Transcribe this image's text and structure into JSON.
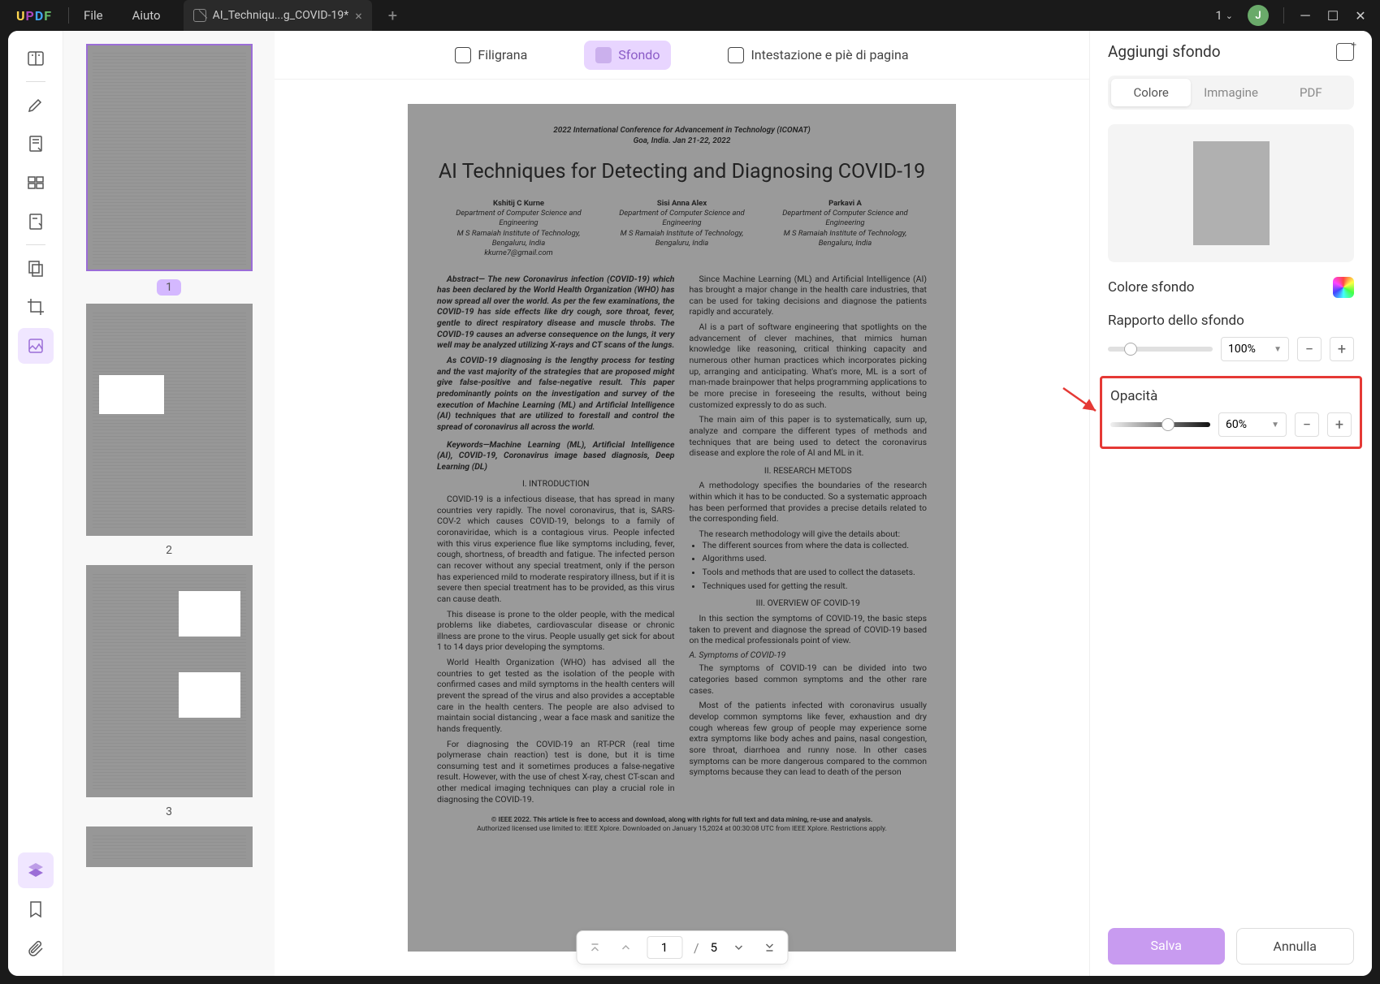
{
  "titlebar": {
    "menu_file": "File",
    "menu_help": "Aiuto",
    "tab_name": "AI_Techniqu...g_COVID-19*",
    "window_count": "1",
    "avatar_letter": "J"
  },
  "modebar": {
    "watermark": "Filigrana",
    "background": "Sfondo",
    "header_footer": "Intestazione e piè di pagina"
  },
  "thumbs": {
    "labels": [
      "1",
      "2",
      "3"
    ]
  },
  "page_content": {
    "conf_line1": "2022 International Conference for Advancement in Technology (ICONAT)",
    "conf_line2": "Goa, India. Jan 21-22, 2022",
    "title": "AI Techniques for Detecting and Diagnosing COVID-19",
    "a1_name": "Kshitij C Kurne",
    "a1_l1": "Department of Computer Science and",
    "a1_l2": "Engineering",
    "a1_l3": "M S Ramaiah Institute of Technology,",
    "a1_l4": "Bengaluru, India",
    "a1_l5": "kkurne7@gmail.com",
    "a2_name": "Sisi Anna Alex",
    "a2_l1": "Department of Computer Science and",
    "a2_l2": "Engineering",
    "a2_l3": "M S Ramaiah Institute of Technology,",
    "a2_l4": "Bengaluru, India",
    "a3_name": "Parkavi A",
    "a3_l1": "Department of Computer Science and",
    "a3_l2": "Engineering",
    "a3_l3": "M S Ramaiah Institute of Technology,",
    "a3_l4": "Bengaluru, India",
    "abstract": "Abstract— The new Coronavirus infection (COVID-19) which has been declared by the World Health Organization (WHO) has now spread all over the world. As per the few examinations, the COVID-19 has side effects like dry cough, sore throat, fever, gentle to direct respiratory disease and muscle throbs. The COVID-19 causes an adverse consequence on the lungs, it very well may be analyzed utilizing X-rays and CT scans of the lungs.",
    "p2": "As COVID-19 diagnosing is the lengthy process for testing and the vast majority of the strategies that are proposed might give false-positive and false-negative result. This paper predominantly points on the investigation and survey of the execution of Machine Learning (ML) and Artificial Intelligence (AI) techniques that are utilized to forestall and control the spread of coronavirus all across the world.",
    "kw": "Keywords—Machine Learning (ML), Artificial Intelligence (AI), COVID-19, Coronavirus image based diagnosis, Deep Learning (DL)",
    "s1": "I.     INTRODUCTION",
    "p3": "COVID-19 is a infectious disease, that has spread in many countries very rapidly. The novel coronavirus, that is, SARS-COV-2 which causes COVID-19, belongs to a family of coronaviridae, which is a contagious virus. People infected with this virus experience flue like symptoms including, fever, cough, shortness, of breadth and fatigue. The infected person can recover without any special treatment, only if the person has experienced mild to moderate respiratory illness, but if it is severe then special treatment has to be provided, as this virus can cause death.",
    "p4": "This disease is prone to the older people, with the medical problems like diabetes, cardiovascular disease or chronic illness are prone to the virus. People usually get sick for about 1 to 14 days prior developing the symptoms.",
    "p5": "World Health Organization (WHO) has advised all the countries to get tested as the isolation of the people with confirmed cases and mild symptoms in the health centers will prevent the spread of the virus and also provides a acceptable care in the health centers. The people are also advised to maintain social distancing , wear a face mask and sanitize the hands frequently.",
    "p6": "For diagnosing the COVID-19 an RT-PCR (real time polymerase chain reaction) test is done, but it is time consuming test and it sometimes produces a false-negative result. However, with the use of chest X-ray, chest CT-scan and other medical imaging techniques can play a crucial role in diagnosing the COVID-19.",
    "r1": "Since Machine Learning (ML) and Artificial Intelligence (AI) has brought a major change in the health care industries, that can be used for taking decisions and diagnose the patients rapidly and accurately.",
    "r2": "AI is a part of software engineering that spotlights on the advancement of clever machines, that mimics human knowledge like reasoning, critical thinking capacity and numerous other human practices which incorporates picking up, arranging and anticipating. What's more, ML is a sort of man-made brainpower that helps programming applications to be more precise in foreseeing the results, without being customized expressly to do as such.",
    "r3": "The main aim of this paper is to systematically, sum up, analyze and compare the different types of methods and techniques that are being used to detect the coronavirus disease and explore the role of AI and ML in it.",
    "s2": "II.     RESEARCH METODS",
    "r4": "A methodology specifies the boundaries of the research within which it has to be conducted. So a systematic approach has been performed that provides a precise details related to the corresponding field.",
    "r5": "The research methodology will give the details about:",
    "b1": "The different sources from where the data is collected.",
    "b2": "Algorithms used.",
    "b3": "Tools and methods that are used to collect the datasets.",
    "b4": "Techniques used for getting the result.",
    "s3": "III.    OVERVIEW OF COVID-19",
    "r6": "In this section the symptoms of COVID-19, the basic steps taken to prevent and diagnose the spread of COVID-19 based on the medical professionals point of view.",
    "sA": "A.  Symptoms of COVID-19",
    "r7": "The symptoms of COVID-19 can be divided into two categories based common symptoms and the other rare cases.",
    "r8": "Most of the patients infected with coronavirus usually develop common symptoms like fever, exhaustion and dry cough whereas few group of people may experience some extra symptoms like body aches and pains, nasal congestion, sore throat, diarrhoea and runny nose. In other cases symptoms can be more dangerous compared to the common symptoms because they can lead to death of the person",
    "foot1": "© IEEE 2022. This article is free to access and download, along with rights for full text and data mining, re-use and analysis.",
    "foot2": "Authorized licensed use limited to: IEEE Xplore. Downloaded on January 15,2024 at 00:30:08 UTC from IEEE Xplore. Restrictions apply."
  },
  "pager": {
    "current": "1",
    "total": "5"
  },
  "right": {
    "title": "Aggiungi sfondo",
    "seg_color": "Colore",
    "seg_image": "Immagine",
    "seg_pdf": "PDF",
    "bg_color": "Colore sfondo",
    "ratio": "Rapporto dello sfondo",
    "ratio_val": "100%",
    "opacity": "Opacità",
    "opacity_val": "60%",
    "save": "Salva",
    "cancel": "Annulla"
  }
}
